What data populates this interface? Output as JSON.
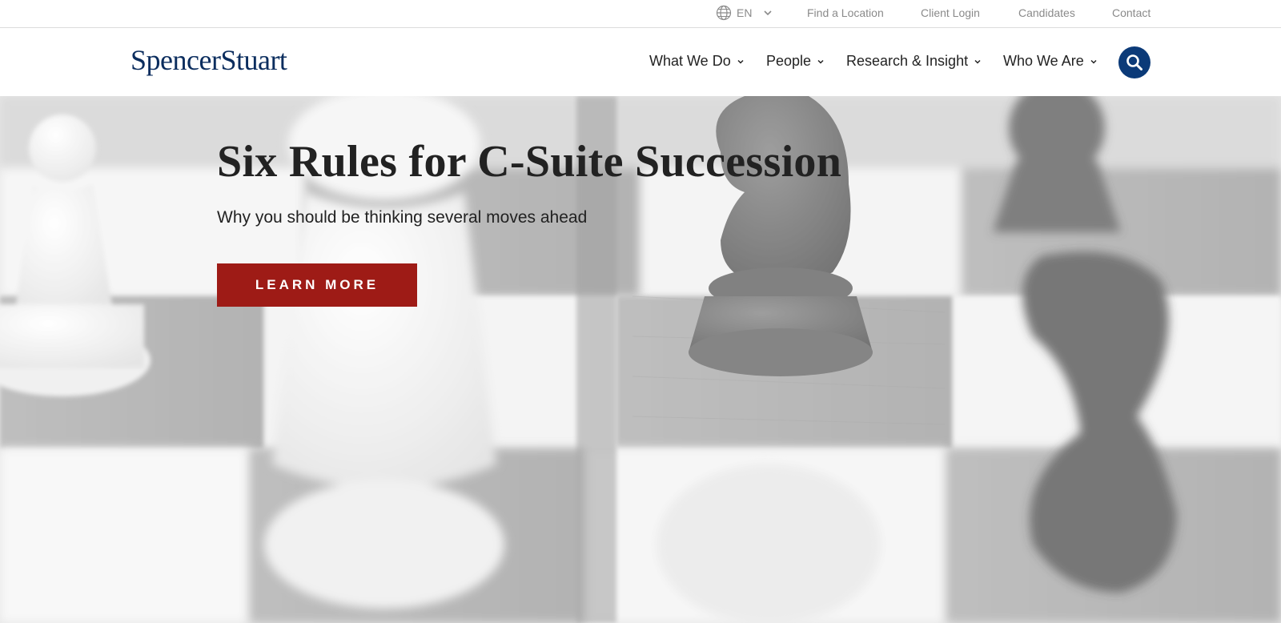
{
  "utility": {
    "language": "EN",
    "links": [
      "Find a Location",
      "Client Login",
      "Candidates",
      "Contact"
    ]
  },
  "header": {
    "logo": "SpencerStuart",
    "nav": [
      "What We Do",
      "People",
      "Research & Insight",
      "Who We Are"
    ]
  },
  "hero": {
    "title": "Six Rules for C-Suite Succession",
    "subtitle": "Why you should be thinking several moves ahead",
    "cta": "LEARN MORE"
  },
  "colors": {
    "brand_navy": "#0b2d5e",
    "search_blue": "#0b3a78",
    "cta_red": "#9e1b16"
  },
  "icons": {
    "language": "globe-icon",
    "nav_dropdown": "chevron-down-icon",
    "search": "search-icon"
  }
}
